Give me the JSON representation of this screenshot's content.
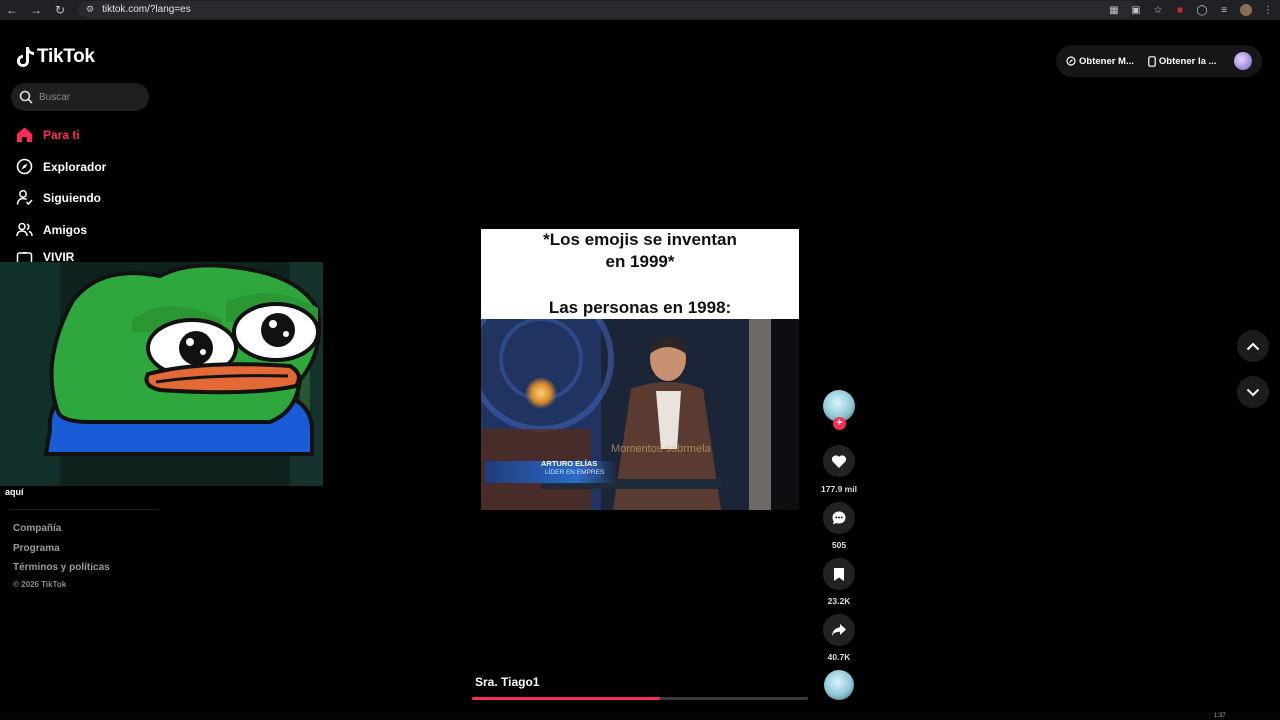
{
  "browser": {
    "url": "tiktok.com/?lang=es"
  },
  "sidebar": {
    "logo_text": "TikTok",
    "search_placeholder": "Buscar",
    "nav": [
      {
        "label": "Para ti",
        "icon": "home-icon",
        "active": true
      },
      {
        "label": "Explorador",
        "icon": "compass-icon",
        "active": false
      },
      {
        "label": "Siguiendo",
        "icon": "following-icon",
        "active": false
      },
      {
        "label": "Amigos",
        "icon": "friends-icon",
        "active": false
      },
      {
        "label": "VIVIR",
        "icon": "live-icon",
        "active": false
      }
    ],
    "overlay_caption": "aquí",
    "footer_links": [
      "Compañía",
      "Programa",
      "Términos y políticas"
    ],
    "copyright": "© 2026 TikTok"
  },
  "top_actions": {
    "get_coins": "Obtener M...",
    "get_app": "Obtener la ..."
  },
  "video": {
    "meme_line1": "*Los emojis se inventan",
    "meme_line2": "en 1999*",
    "meme_line3": "Las personas en 1998:",
    "lower_third_name": "ARTURO ELÍAS",
    "lower_third_role": "LÍDER EN EMPRES",
    "watermark": "Momentos sobrmela",
    "author": "Sra. Tiago1",
    "progress": 0.56
  },
  "rail": {
    "likes": "177.9 mil",
    "comments": "505",
    "saves": "23.2K",
    "shares": "40.7K"
  },
  "taskbar": {
    "time": "1:37"
  },
  "colors": {
    "accent": "#fe2c55",
    "background": "#000000"
  }
}
